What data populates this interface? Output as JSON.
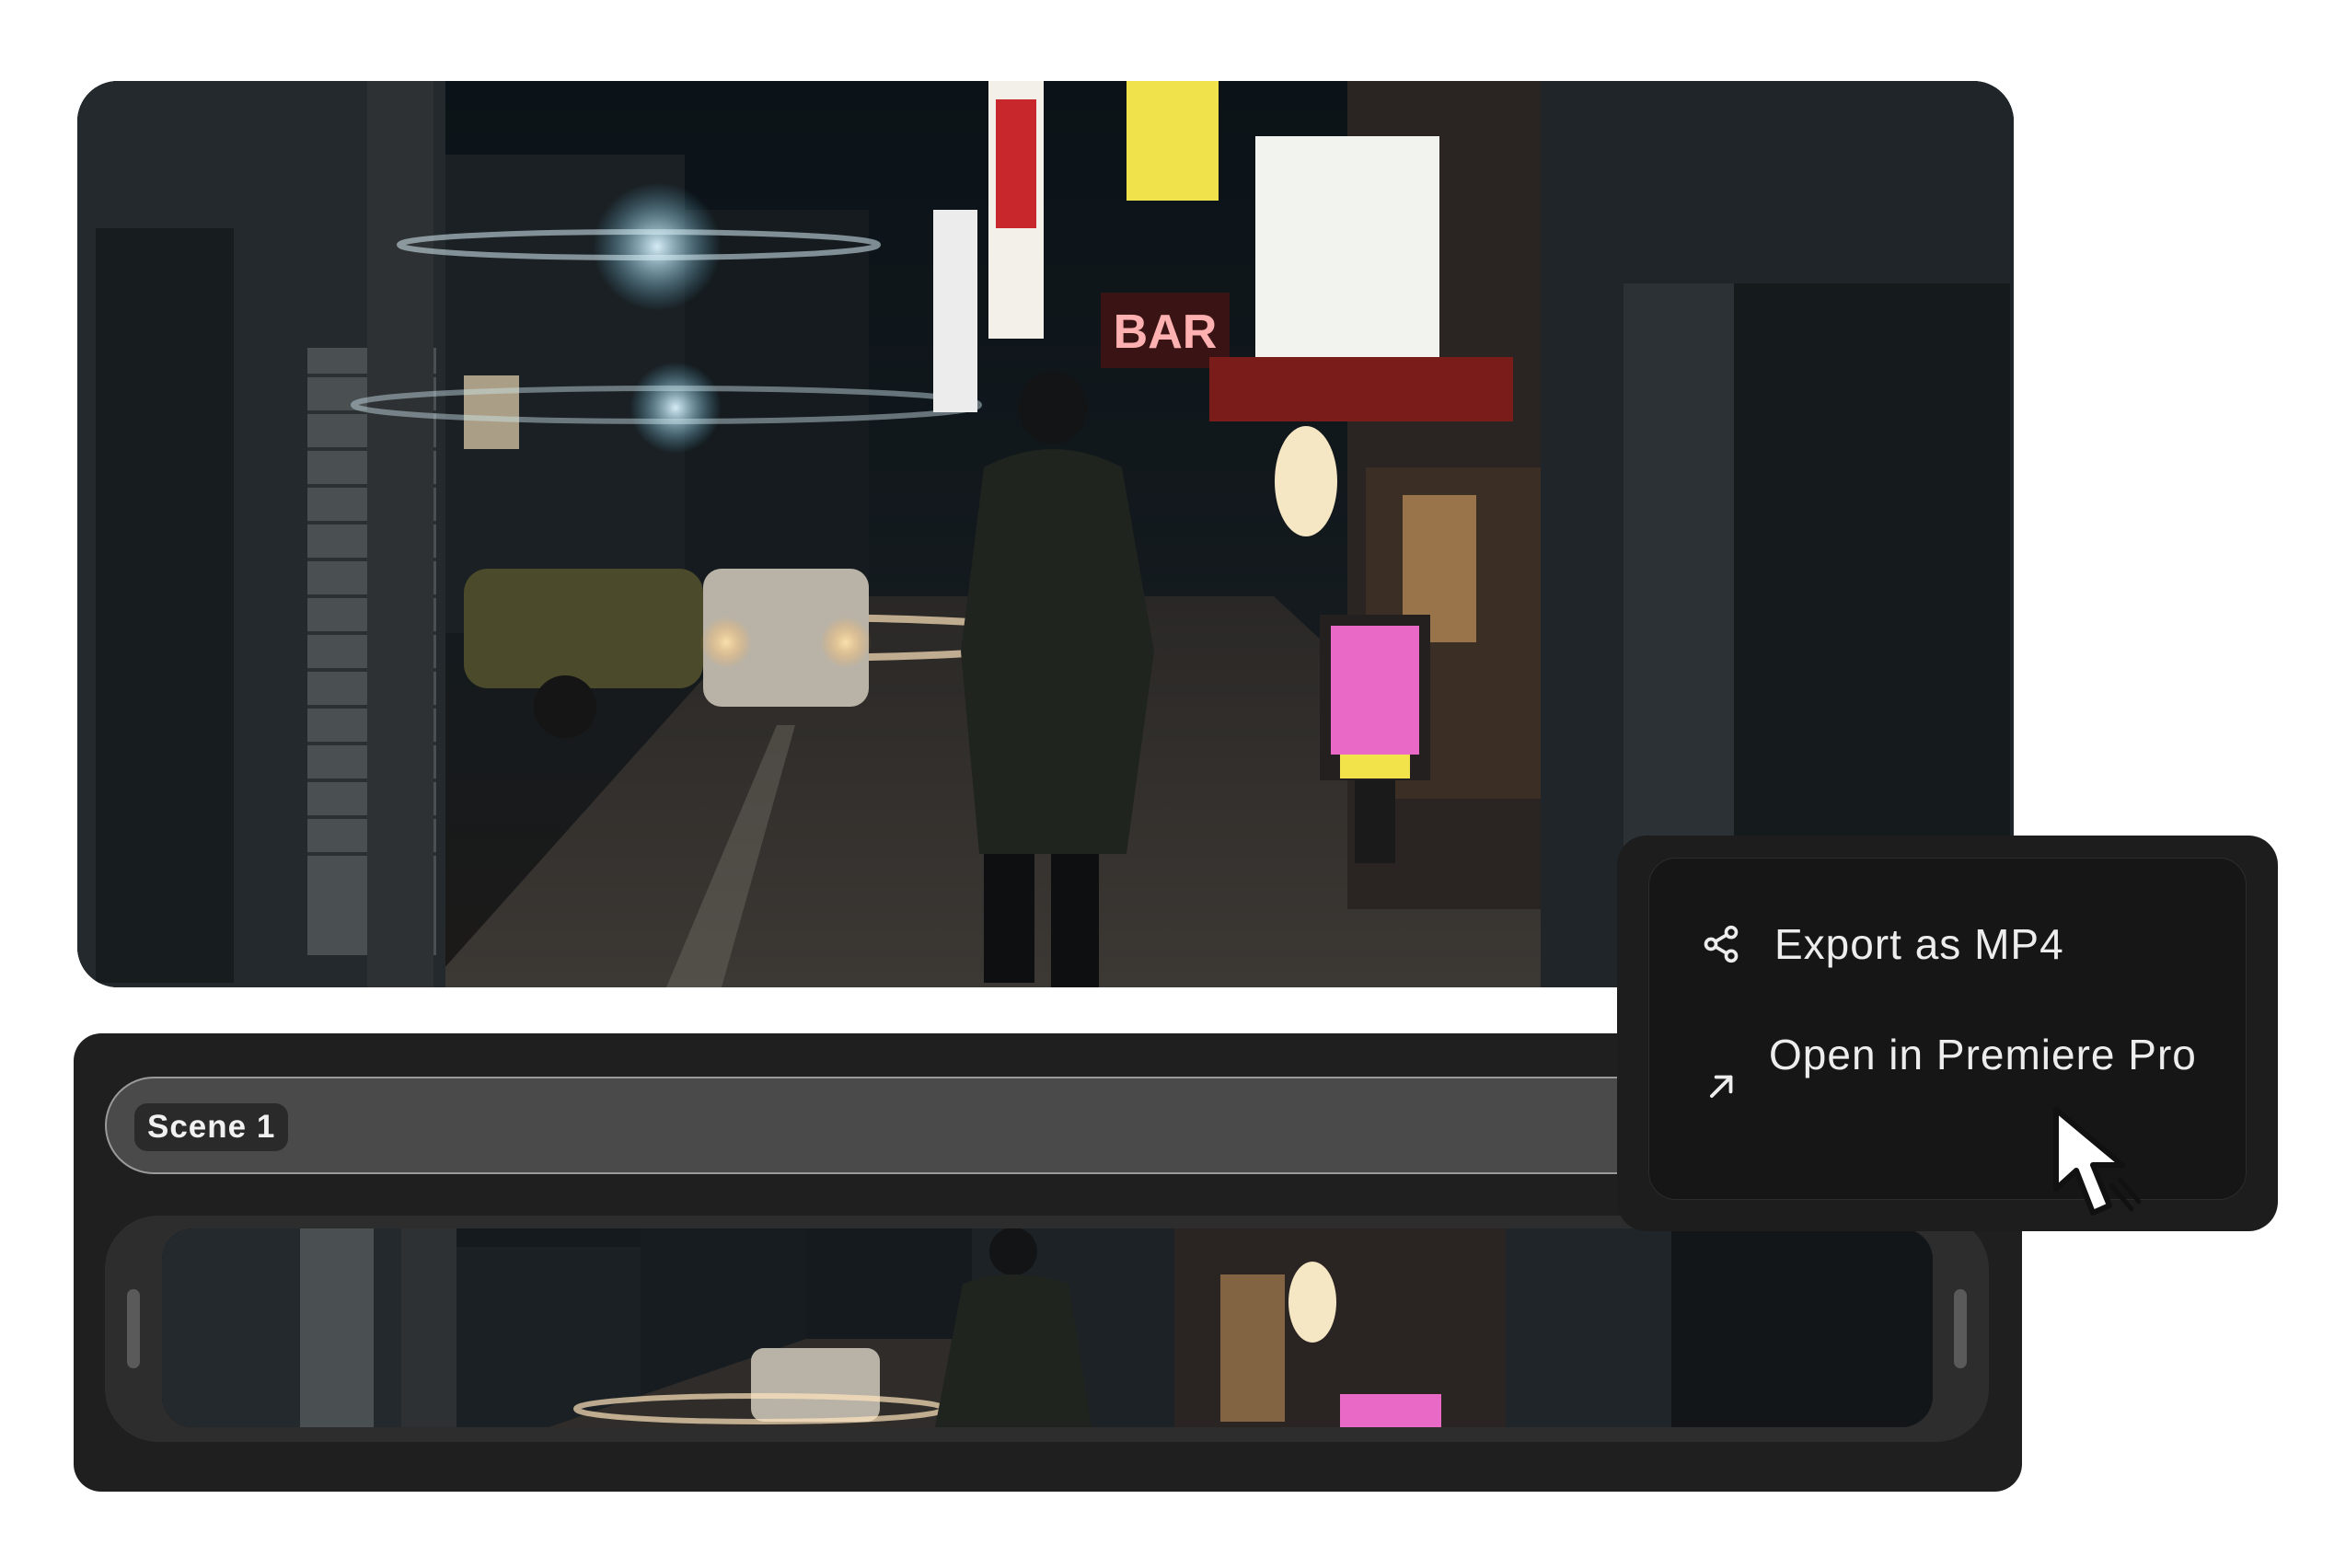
{
  "timeline": {
    "scene_label": "Scene 1"
  },
  "context_menu": {
    "items": [
      {
        "label": "Export as MP4",
        "icon": "share-icon"
      },
      {
        "label": "Open in Premiere Pro",
        "icon": "arrow-up-right-icon"
      }
    ]
  },
  "cursor": {
    "icon": "hand-pointer-icon"
  },
  "colors": {
    "background": "#ffffff",
    "panel": "#1f1f1f",
    "scene_bar": "#4a4a4a",
    "menu": "#1d1d1d",
    "menu_text": "#ededed"
  }
}
